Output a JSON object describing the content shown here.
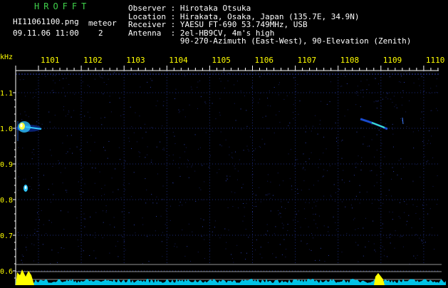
{
  "header": {
    "logo": "HROFFT",
    "filename": "HI11061100.png",
    "timestamp": "09.11.06 11:00",
    "meteor_label": "meteor",
    "meteor_count": "2"
  },
  "info": {
    "rows": [
      {
        "label": "Observer",
        "sep": ":",
        "value": "Hirotaka Otsuka"
      },
      {
        "label": "Location",
        "sep": ":",
        "value": "Hirakata, Osaka, Japan (135.7E, 34.9N)"
      },
      {
        "label": "Receiver",
        "sep": ":",
        "value": "YAESU FT-690 53.749MHz, USB"
      },
      {
        "label": "Antenna",
        "sep": ":",
        "value": "2el-HB9CV, 4m's high"
      },
      {
        "label": "",
        "sep": "",
        "value": "90-270-Azimuth (East-West), 90-Elevation (Zenith)"
      }
    ]
  },
  "spectrogram": {
    "y_unit": "kHz",
    "y_ticks": [
      "1.1",
      "1.0",
      "0.9",
      "0.8",
      "0.7",
      "0.6"
    ],
    "time_ticks": [
      "1101",
      "1102",
      "1103",
      "1104",
      "1105",
      "1106",
      "1107",
      "1108",
      "1109",
      "1110"
    ],
    "colors": {
      "axis": "#ffffff",
      "grid": "#1b2a78",
      "tick_label": "#ffff00",
      "echo_core": "#ffffff",
      "echo_hot": "#ffff40",
      "echo_warm": "#30c8ff",
      "baseline": "#00d8ff",
      "baseline_peak": "#ffff00",
      "ref_line": "#c8c8c8"
    }
  }
}
